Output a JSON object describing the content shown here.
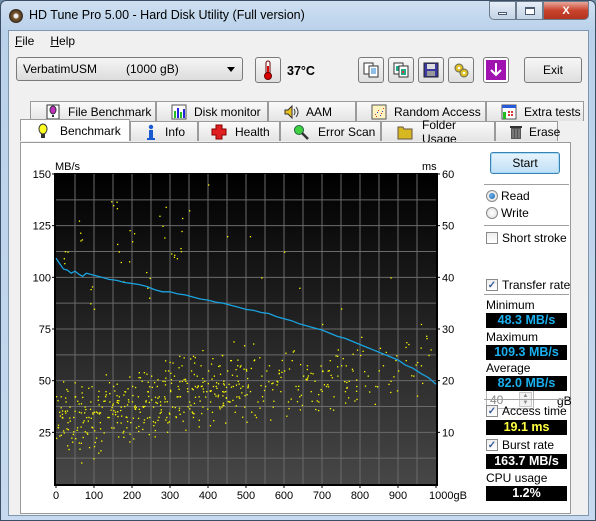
{
  "window": {
    "title": "HD Tune Pro 5.00 - Hard Disk Utility (Full version)",
    "controls": {
      "minimize": "—",
      "maximize": "□",
      "close": "X"
    }
  },
  "menu": [
    {
      "label": "File",
      "accel": "F",
      "rest": "ile"
    },
    {
      "label": "Help",
      "accel": "H",
      "rest": "elp"
    }
  ],
  "toolbar": {
    "drive_name": "VerbatimUSM",
    "drive_capacity": "(1000 gB)",
    "temperature": "37°C",
    "icons": [
      "thermometer-icon",
      "copy-text-icon",
      "copy-screenshot-icon",
      "save-icon",
      "options-icon",
      "download-icon"
    ],
    "exit_label": "Exit"
  },
  "tabs": {
    "top_row": [
      {
        "label": "File Benchmark",
        "icon": "file-benchmark-icon"
      },
      {
        "label": "Disk monitor",
        "icon": "disk-monitor-icon"
      },
      {
        "label": "AAM",
        "icon": "speaker-icon"
      },
      {
        "label": "Random Access",
        "icon": "random-access-icon"
      },
      {
        "label": "Extra tests",
        "icon": "extra-tests-icon"
      }
    ],
    "bottom_row": [
      {
        "label": "Benchmark",
        "icon": "benchmark-icon",
        "active": true
      },
      {
        "label": "Info",
        "icon": "info-icon"
      },
      {
        "label": "Health",
        "icon": "health-icon"
      },
      {
        "label": "Error Scan",
        "icon": "magnifier-icon"
      },
      {
        "label": "Folder Usage",
        "icon": "folder-icon"
      },
      {
        "label": "Erase",
        "icon": "trash-icon"
      }
    ]
  },
  "controls": {
    "start_label": "Start",
    "mode_options": [
      "Read",
      "Write"
    ],
    "mode_selected": "Read",
    "short_stroke_label": "Short stroke",
    "short_stroke_checked": false,
    "short_stroke_value": "40",
    "short_stroke_unit": "gB",
    "transfer_rate_label": "Transfer rate",
    "transfer_rate_checked": true,
    "minimum_label": "Minimum",
    "minimum_value": "48.3 MB/s",
    "maximum_label": "Maximum",
    "maximum_value": "109.3 MB/s",
    "average_label": "Average",
    "average_value": "82.0 MB/s",
    "access_time_label": "Access time",
    "access_time_checked": true,
    "access_time_value": "19.1 ms",
    "burst_rate_label": "Burst rate",
    "burst_rate_checked": true,
    "burst_rate_value": "163.7 MB/s",
    "cpu_usage_label": "CPU usage",
    "cpu_usage_value": "1.2%"
  },
  "colors": {
    "transfer_line": "#1aa3e0",
    "access_dots": "#ffff00",
    "readout_blue": "#1ab0f0",
    "readout_yellow": "#ffff40",
    "readout_white": "#ffffff"
  },
  "chart_data": {
    "type": "line",
    "title": "",
    "xlabel": "gB",
    "ylabel_left": "MB/s",
    "ylabel_right": "ms",
    "xlim": [
      0,
      1000
    ],
    "ylim_left": [
      0,
      150
    ],
    "ylim_right": [
      0,
      60
    ],
    "x_ticks": [
      0,
      100,
      200,
      300,
      400,
      500,
      600,
      700,
      800,
      900,
      1000
    ],
    "x_tick_labels": [
      "0",
      "100",
      "200",
      "300",
      "400",
      "500",
      "600",
      "700",
      "800",
      "900",
      "1000gB"
    ],
    "y_left_ticks": [
      25,
      50,
      75,
      100,
      125,
      150
    ],
    "y_right_ticks": [
      10,
      20,
      30,
      40,
      50,
      60
    ],
    "grid": true,
    "series": [
      {
        "name": "Transfer rate (MB/s)",
        "axis": "left",
        "x": [
          0,
          10,
          20,
          30,
          40,
          50,
          60,
          70,
          80,
          90,
          100,
          120,
          140,
          160,
          180,
          200,
          220,
          240,
          260,
          280,
          300,
          320,
          340,
          360,
          380,
          400,
          420,
          440,
          460,
          480,
          500,
          520,
          540,
          560,
          580,
          600,
          620,
          640,
          660,
          680,
          700,
          720,
          740,
          760,
          780,
          800,
          820,
          840,
          860,
          880,
          900,
          920,
          940,
          960,
          980,
          1000
        ],
        "values": [
          109.3,
          106.5,
          104,
          103.5,
          102,
          103,
          101.5,
          100.5,
          102,
          101.5,
          101,
          100,
          99,
          98.5,
          97.5,
          97,
          96.5,
          95.5,
          94,
          93,
          93,
          92,
          91.5,
          90.5,
          89.5,
          89,
          88,
          87.5,
          86.5,
          85.5,
          84.5,
          84,
          83,
          82.5,
          81,
          80,
          79,
          77.5,
          76.5,
          75.5,
          74.5,
          73,
          71.5,
          70.5,
          69,
          67.5,
          66,
          64.5,
          63,
          61.5,
          60,
          57.5,
          56,
          53.5,
          51.5,
          48.3
        ]
      },
      {
        "name": "Access time (ms)",
        "axis": "right",
        "type": "scatter",
        "summary": "Dense scatter of ~600 points, mostly between 5 and 25 ms, average 19.1 ms, rising slightly with position; sparse outliers up to ~58 ms",
        "points": [
          [
            5,
            11
          ],
          [
            8,
            14
          ],
          [
            12,
            17
          ],
          [
            15,
            13
          ],
          [
            20,
            10
          ],
          [
            25,
            16
          ],
          [
            30,
            12
          ],
          [
            35,
            15
          ],
          [
            40,
            9
          ],
          [
            45,
            13
          ],
          [
            50,
            17
          ],
          [
            55,
            11
          ],
          [
            60,
            14
          ],
          [
            65,
            8
          ],
          [
            70,
            12
          ],
          [
            75,
            15
          ],
          [
            80,
            10
          ],
          [
            85,
            13
          ],
          [
            90,
            16
          ],
          [
            95,
            11
          ],
          [
            100,
            14
          ],
          [
            105,
            9
          ],
          [
            110,
            17
          ],
          [
            115,
            12
          ],
          [
            120,
            15
          ],
          [
            125,
            10
          ],
          [
            130,
            18
          ],
          [
            135,
            13
          ],
          [
            140,
            16
          ],
          [
            145,
            11
          ],
          [
            150,
            19
          ],
          [
            155,
            14
          ],
          [
            160,
            12
          ],
          [
            165,
            17
          ],
          [
            170,
            15
          ],
          [
            175,
            10
          ],
          [
            180,
            18
          ],
          [
            185,
            13
          ],
          [
            190,
            16
          ],
          [
            195,
            12
          ],
          [
            200,
            19
          ],
          [
            205,
            15
          ],
          [
            210,
            11
          ],
          [
            215,
            17
          ],
          [
            220,
            14
          ],
          [
            225,
            20
          ],
          [
            230,
            12
          ],
          [
            235,
            16
          ],
          [
            240,
            18
          ],
          [
            245,
            13
          ],
          [
            250,
            21
          ],
          [
            255,
            15
          ],
          [
            260,
            12
          ],
          [
            265,
            19
          ],
          [
            270,
            17
          ],
          [
            275,
            14
          ],
          [
            280,
            20
          ],
          [
            285,
            16
          ],
          [
            290,
            13
          ],
          [
            295,
            22
          ],
          [
            300,
            18
          ],
          [
            305,
            15
          ],
          [
            310,
            21
          ],
          [
            315,
            13
          ],
          [
            320,
            19
          ],
          [
            325,
            17
          ],
          [
            330,
            23
          ],
          [
            335,
            14
          ],
          [
            340,
            20
          ],
          [
            345,
            18
          ],
          [
            350,
            16
          ],
          [
            355,
            22
          ],
          [
            360,
            13
          ],
          [
            365,
            19
          ],
          [
            370,
            21
          ],
          [
            375,
            17
          ],
          [
            380,
            23
          ],
          [
            385,
            15
          ],
          [
            390,
            20
          ],
          [
            395,
            18
          ],
          [
            400,
            22
          ],
          [
            405,
            16
          ],
          [
            410,
            14
          ],
          [
            415,
            21
          ],
          [
            420,
            19
          ],
          [
            425,
            17
          ],
          [
            430,
            23
          ],
          [
            435,
            15
          ],
          [
            440,
            20
          ],
          [
            445,
            18
          ],
          [
            450,
            22
          ],
          [
            455,
            16
          ],
          [
            460,
            24
          ],
          [
            465,
            19
          ],
          [
            470,
            14
          ],
          [
            475,
            21
          ],
          [
            480,
            17
          ],
          [
            485,
            23
          ],
          [
            490,
            19
          ],
          [
            495,
            15
          ],
          [
            500,
            22
          ],
          [
            510,
            18
          ],
          [
            520,
            24
          ],
          [
            530,
            16
          ],
          [
            540,
            21
          ],
          [
            550,
            19
          ],
          [
            560,
            23
          ],
          [
            570,
            15
          ],
          [
            580,
            20
          ],
          [
            590,
            18
          ],
          [
            600,
            22
          ],
          [
            610,
            16
          ],
          [
            620,
            24
          ],
          [
            630,
            19
          ],
          [
            640,
            17
          ],
          [
            650,
            21
          ],
          [
            660,
            23
          ],
          [
            670,
            18
          ],
          [
            680,
            20
          ],
          [
            690,
            16
          ],
          [
            700,
            22
          ],
          [
            710,
            19
          ],
          [
            720,
            24
          ],
          [
            730,
            17
          ],
          [
            740,
            21
          ],
          [
            750,
            23
          ],
          [
            760,
            18
          ],
          [
            770,
            20
          ],
          [
            780,
            22
          ],
          [
            790,
            19
          ],
          [
            800,
            25
          ],
          [
            820,
            21
          ],
          [
            840,
            19
          ],
          [
            860,
            23
          ],
          [
            880,
            20
          ],
          [
            900,
            22
          ],
          [
            920,
            24
          ],
          [
            940,
            21
          ],
          [
            960,
            23
          ],
          [
            980,
            25
          ],
          [
            30,
            45
          ],
          [
            60,
            51
          ],
          [
            90,
            35
          ],
          [
            150,
            54
          ],
          [
            170,
            43
          ],
          [
            200,
            47
          ],
          [
            240,
            38
          ],
          [
            280,
            50
          ],
          [
            310,
            44
          ],
          [
            330,
            49
          ],
          [
            350,
            53
          ],
          [
            400,
            58
          ],
          [
            450,
            48
          ],
          [
            510,
            48
          ],
          [
            540,
            40
          ],
          [
            600,
            45
          ],
          [
            640,
            38
          ],
          [
            700,
            31
          ],
          [
            750,
            34
          ],
          [
            880,
            40
          ],
          [
            960,
            31
          ]
        ]
      }
    ]
  }
}
